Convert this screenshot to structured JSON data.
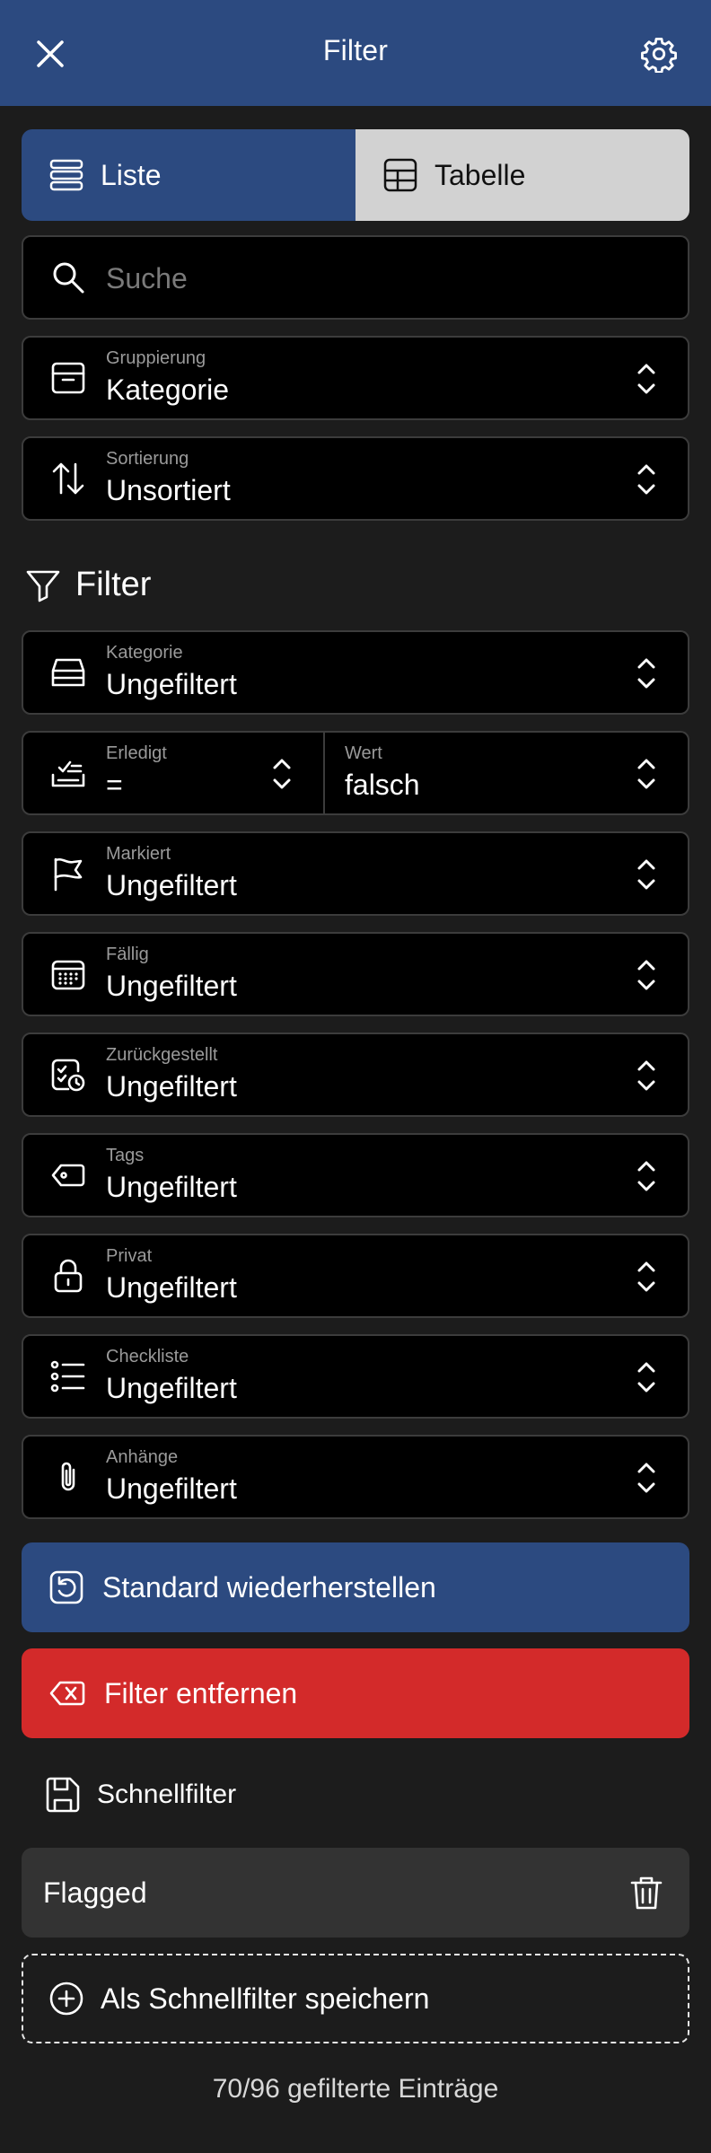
{
  "header": {
    "title": "Filter"
  },
  "view_toggle": {
    "list_label": "Liste",
    "table_label": "Tabelle",
    "selected": "Liste"
  },
  "search": {
    "placeholder": "Suche",
    "value": ""
  },
  "grouping": {
    "label": "Gruppierung",
    "value": "Kategorie"
  },
  "sorting": {
    "label": "Sortierung",
    "value": "Unsortiert"
  },
  "filter_section": {
    "title": "Filter"
  },
  "filters": {
    "category": {
      "label": "Kategorie",
      "value": "Ungefiltert"
    },
    "done": {
      "label": "Erledigt",
      "operator": "=",
      "value_label": "Wert",
      "value": "falsch"
    },
    "flagged": {
      "label": "Markiert",
      "value": "Ungefiltert"
    },
    "due": {
      "label": "Fällig",
      "value": "Ungefiltert"
    },
    "deferred": {
      "label": "Zurückgestellt",
      "value": "Ungefiltert"
    },
    "tags": {
      "label": "Tags",
      "value": "Ungefiltert"
    },
    "private": {
      "label": "Privat",
      "value": "Ungefiltert"
    },
    "checklist": {
      "label": "Checkliste",
      "value": "Ungefiltert"
    },
    "attachments": {
      "label": "Anhänge",
      "value": "Ungefiltert"
    }
  },
  "actions": {
    "restore_label": "Standard wiederherstellen",
    "remove_label": "Filter entfernen"
  },
  "quick_filters": {
    "title": "Schnellfilter",
    "items": [
      {
        "name": "Flagged"
      }
    ],
    "save_label": "Als Schnellfilter speichern"
  },
  "footer": {
    "status": "70/96 gefilterte Einträge"
  },
  "colors": {
    "accent": "#2c4a80",
    "danger": "#d32a2a",
    "background": "#1c1c1c",
    "field": "#000000"
  }
}
